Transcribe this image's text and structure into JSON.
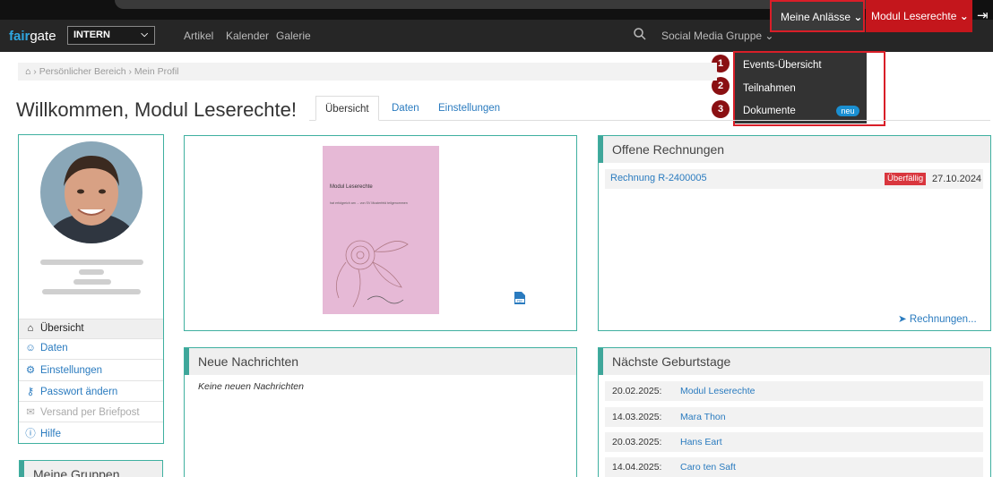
{
  "logo": {
    "fair": "fair",
    "gate": "gate"
  },
  "header": {
    "select_value": "INTERN",
    "nav": [
      "Artikel",
      "Kalender",
      "Galerie"
    ],
    "social_media": "Social Media Gruppe",
    "meine_anlaesse": "Meine Anlässe",
    "user_menu": "Modul Leserechte"
  },
  "dropdown": {
    "items": [
      {
        "num": "1",
        "label": "Events-Übersicht"
      },
      {
        "num": "2",
        "label": "Teilnahmen"
      },
      {
        "num": "3",
        "label": "Dokumente"
      }
    ],
    "badge": "neu"
  },
  "breadcrumb": {
    "items": [
      "Persönlicher Bereich",
      "Mein Profil"
    ]
  },
  "page": {
    "title": "Willkommen, Modul Leserechte!"
  },
  "tabs": [
    "Übersicht",
    "Daten",
    "Einstellungen"
  ],
  "sidebar": {
    "items": [
      {
        "icon": "home-icon",
        "label": "Übersicht"
      },
      {
        "icon": "user-icon",
        "label": "Daten"
      },
      {
        "icon": "gear-icon",
        "label": "Einstellungen"
      },
      {
        "icon": "key-icon",
        "label": "Passwort ändern"
      },
      {
        "icon": "envelope-icon",
        "label": "Versand per Briefpost"
      },
      {
        "icon": "info-icon",
        "label": "Hilfe"
      }
    ],
    "gruppen_title": "Meine Gruppen"
  },
  "document": {
    "title": "Modul Leserechte",
    "subtitle": "hat erfolgreich am ... von SV Musterfeld teilgenommen"
  },
  "rechnungen": {
    "title": "Offene Rechnungen",
    "rows": [
      {
        "label": "Rechnung R-2400005",
        "status": "Überfällig",
        "date": "27.10.2024"
      }
    ],
    "more": "Rechnungen..."
  },
  "nachrichten": {
    "title": "Neue Nachrichten",
    "empty": "Keine neuen Nachrichten"
  },
  "geburtstage": {
    "title": "Nächste Geburtstage",
    "rows": [
      {
        "date": "20.02.2025:",
        "name": "Modul Leserechte"
      },
      {
        "date": "14.03.2025:",
        "name": "Mara Thon"
      },
      {
        "date": "20.03.2025:",
        "name": "Hans Eart"
      },
      {
        "date": "14.04.2025:",
        "name": "Caro ten Saft"
      }
    ]
  },
  "colors": {
    "accent": "#3fb0a0",
    "highlight": "#d91e28",
    "user_menu_bg": "#c4161c",
    "link": "#2a7bbf"
  }
}
